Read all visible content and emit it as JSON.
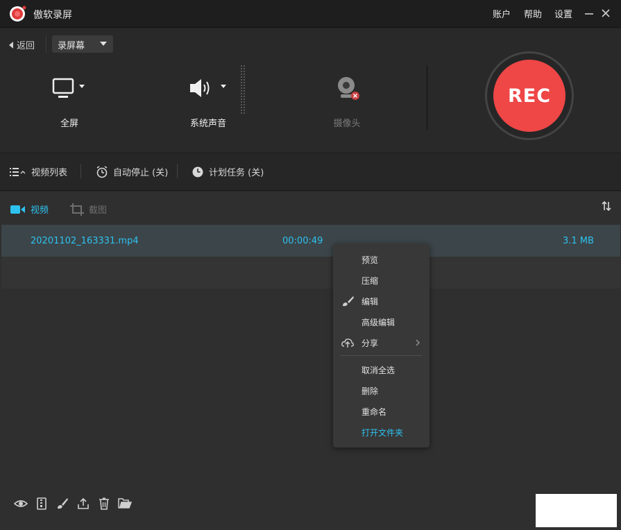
{
  "titlebar": {
    "title": "傲软录屏",
    "account": "账户",
    "help": "帮助",
    "settings": "设置"
  },
  "top": {
    "back": "返回",
    "mode": "录屏幕",
    "sources": {
      "screen": "全屏",
      "audio": "系统声音",
      "camera": "摄像头"
    },
    "rec": "REC"
  },
  "toolbar": {
    "video_list": "视频列表",
    "auto_stop": "自动停止 (关)",
    "schedule": "计划任务 (关)"
  },
  "tabs": {
    "video": "视频",
    "screenshot": "截图"
  },
  "files": [
    {
      "name": "20201102_163331.mp4",
      "duration": "00:00:49",
      "size": "3.1 MB"
    }
  ],
  "context_menu": {
    "preview": "预览",
    "compress": "压缩",
    "edit": "编辑",
    "advanced_edit": "高级编辑",
    "share": "分享",
    "deselect_all": "取消全选",
    "delete": "删除",
    "rename": "重命名",
    "open_folder": "打开文件夹"
  },
  "colors": {
    "accent": "#2ec2f0",
    "rec": "#ef4646",
    "background": "#262626"
  }
}
